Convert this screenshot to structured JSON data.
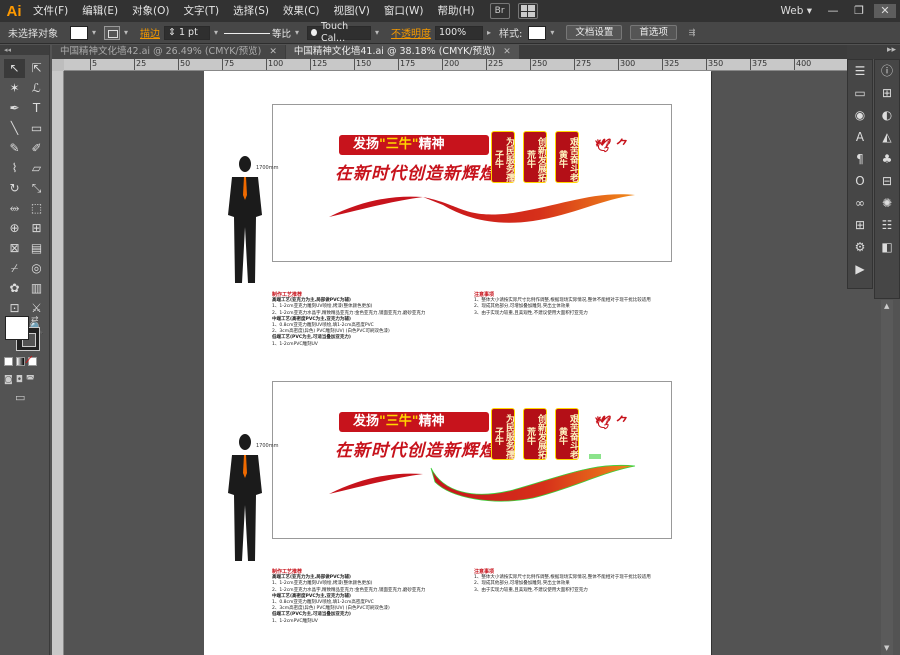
{
  "app": {
    "logo": "Ai",
    "accent": "#ff9a00"
  },
  "menu": [
    "文件(F)",
    "编辑(E)",
    "对象(O)",
    "文字(T)",
    "选择(S)",
    "效果(C)",
    "视图(V)",
    "窗口(W)",
    "帮助(H)"
  ],
  "menu_extra": {
    "bridge": "Br",
    "workspace": "Web",
    "workspace_arrow": "▾"
  },
  "window_controls": {
    "minimize": "—",
    "restore": "❐",
    "close": "✕"
  },
  "control": {
    "no_selection": "未选择对象",
    "stroke_label": "描边",
    "stroke_weight": "1 pt",
    "profile": "等比",
    "brush": "Touch Cal...",
    "opacity_label": "不透明度",
    "opacity": "100%",
    "style_label": "样式:",
    "doc_setup": "文档设置",
    "preferences": "首选项"
  },
  "tabs": [
    {
      "label": "中国精神文化墙42.ai @ 26.49% (CMYK/预览)",
      "close": "✕"
    },
    {
      "label": "中国精神文化墙41.ai @ 38.18% (CMYK/预览)",
      "close": "✕"
    }
  ],
  "tools": [
    {
      "name": "selection-tool",
      "glyph": "↖"
    },
    {
      "name": "direct-selection-tool",
      "glyph": "⇱"
    },
    {
      "name": "magic-wand-tool",
      "glyph": "✶"
    },
    {
      "name": "lasso-tool",
      "glyph": "ℒ"
    },
    {
      "name": "pen-tool",
      "glyph": "✒"
    },
    {
      "name": "type-tool",
      "glyph": "T"
    },
    {
      "name": "line-tool",
      "glyph": "╲"
    },
    {
      "name": "rectangle-tool",
      "glyph": "▭"
    },
    {
      "name": "paintbrush-tool",
      "glyph": "✎"
    },
    {
      "name": "pencil-tool",
      "glyph": "✐"
    },
    {
      "name": "blob-brush-tool",
      "glyph": "⌇"
    },
    {
      "name": "eraser-tool",
      "glyph": "▱"
    },
    {
      "name": "rotate-tool",
      "glyph": "↻"
    },
    {
      "name": "scale-tool",
      "glyph": "⤡"
    },
    {
      "name": "width-tool",
      "glyph": "⥈"
    },
    {
      "name": "free-transform-tool",
      "glyph": "⬚"
    },
    {
      "name": "shape-builder-tool",
      "glyph": "⊕"
    },
    {
      "name": "perspective-grid-tool",
      "glyph": "⊞"
    },
    {
      "name": "mesh-tool",
      "glyph": "⊠"
    },
    {
      "name": "gradient-tool",
      "glyph": "▤"
    },
    {
      "name": "eyedropper-tool",
      "glyph": "⌿"
    },
    {
      "name": "blend-tool",
      "glyph": "◎"
    },
    {
      "name": "symbol-sprayer-tool",
      "glyph": "✿"
    },
    {
      "name": "column-graph-tool",
      "glyph": "▥"
    },
    {
      "name": "artboard-tool",
      "glyph": "⊡"
    },
    {
      "name": "slice-tool",
      "glyph": "⚔"
    },
    {
      "name": "hand-tool",
      "glyph": "✋"
    },
    {
      "name": "zoom-tool",
      "glyph": "🔍"
    }
  ],
  "ruler_numbers": [
    "5",
    "25",
    "50",
    "75",
    "100",
    "125",
    "150",
    "175",
    "200",
    "225",
    "250",
    "275",
    "300",
    "325",
    "350",
    "375",
    "400"
  ],
  "artwork": {
    "banner_pre": "发扬",
    "banner_hl": "\"三牛\"",
    "banner_post": "精神",
    "slogan": "在新时代创造新辉煌",
    "lanterns": [
      "为民服务孺子牛",
      "创新发展拓荒牛",
      "艰苦奋斗老黄牛"
    ],
    "birds": "🕊 ⺈",
    "height_mark": "1700mm",
    "craft_title": "制作工艺推荐",
    "craft_lines": [
      "高端工艺(亚克力为主,局部做PVC为辅)",
      "1、1-2cm亚克力雕刻UV喷绘,烤漆(整体颜色更加)",
      "2、1-2cm亚克力水晶字,精致精品亚克力:金色亚克力,镜面亚克力,磨砂亚克力",
      "中端工艺(高密度PVC为主,亚克力为辅)",
      "1、0.8cm亚克力雕刻UV喷绘,填1-2cm高密度PVC",
      "2、3cm高密度(异色) PVC雕刻(UV) (白色PVC可刷双色漆)",
      "低端工艺(PVC为主,可适当叠加亚克力)",
      "1、1-2cmPVC雕刻UV"
    ],
    "notes_title": "注意事项",
    "notes_lines": [
      "1、整体大小请按实际尺寸比例作调整,根据现场实际情况,整体不能相对于现干扰比较适用",
      "2、现成其他部分,可增加叠加雕刻,突出立体效果",
      "3、由于实现力较重,且美观性,不建议使用大面积打亚克力"
    ]
  },
  "right_panels": {
    "col1": [
      "☰",
      "▭",
      "◉",
      "A",
      "¶",
      "O",
      "∞",
      "⊞",
      "⚙",
      "▶"
    ],
    "col2": [
      "ⓘ",
      "⊞",
      "◐",
      "◭",
      "♣",
      "⊟",
      "✺",
      "☷",
      "◧"
    ]
  }
}
